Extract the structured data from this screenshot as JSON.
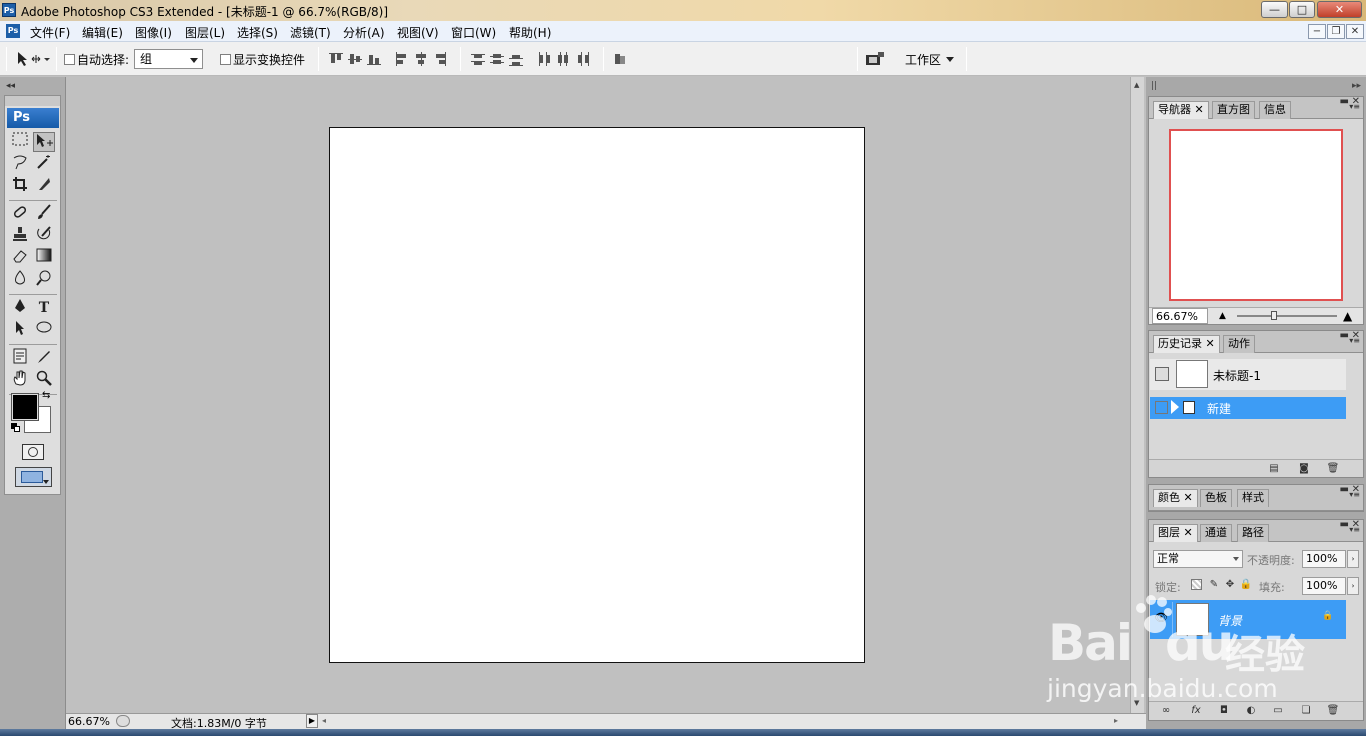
{
  "window": {
    "title": "Adobe Photoshop CS3 Extended - [未标题-1 @ 66.7%(RGB/8)]",
    "app_icon": "Ps",
    "controls": {
      "minimize": "—",
      "maximize": "□",
      "close": "✕"
    }
  },
  "menu": {
    "items": [
      "文件(F)",
      "编辑(E)",
      "图像(I)",
      "图层(L)",
      "选择(S)",
      "滤镜(T)",
      "分析(A)",
      "视图(V)",
      "窗口(W)",
      "帮助(H)"
    ],
    "doc_controls": {
      "minimize": "−",
      "restore": "❐",
      "close": "✕"
    }
  },
  "options": {
    "auto_select_label": "自动选择:",
    "group_value": "组",
    "show_transform_label": "显示变换控件",
    "workspace_label": "工作区"
  },
  "toolbox": {
    "logo": "Ps"
  },
  "status": {
    "zoom": "66.67%",
    "doc_info": "文档:1.83M/0 字节"
  },
  "navigator": {
    "tabs": [
      "导航器",
      "直方图",
      "信息"
    ],
    "zoom": "66.67%"
  },
  "history": {
    "tabs": [
      "历史记录",
      "动作"
    ],
    "snapshot_name": "未标题-1",
    "step_name": "新建"
  },
  "color_panel": {
    "tabs": [
      "颜色",
      "色板",
      "样式"
    ]
  },
  "layers": {
    "tabs": [
      "图层",
      "通道",
      "路径"
    ],
    "blend_mode": "正常",
    "opacity_label": "不透明度:",
    "opacity_value": "100%",
    "lock_label": "锁定:",
    "fill_label": "填充:",
    "fill_value": "100%",
    "layer_name": "背景"
  },
  "watermark": {
    "brand_bai": "Bai",
    "brand_du": "du",
    "brand_jy": "经验",
    "url": "jingyan.baidu.com"
  },
  "colors": {
    "selection_blue": "#3d9cf5",
    "foreground": "#000000",
    "background": "#ffffff",
    "nav_frame": "#e05050"
  }
}
